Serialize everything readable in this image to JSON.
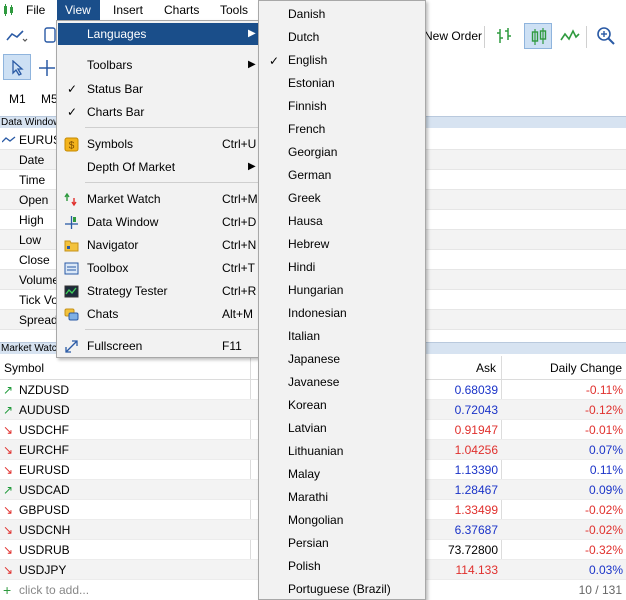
{
  "menubar": {
    "items": [
      "File",
      "View",
      "Insert",
      "Charts",
      "Tools"
    ]
  },
  "toolbar": {
    "new_order_label": "New Order"
  },
  "timeframes": [
    "M1",
    "M5"
  ],
  "data_window": {
    "header": "Data Window",
    "symbol": "EURUSD",
    "rows": [
      "Date",
      "Time",
      "Open",
      "High",
      "Low",
      "Close",
      "Volume",
      "Tick Volume",
      "Spread"
    ]
  },
  "market_watch": {
    "header": "Market Watch",
    "columns": {
      "symbol": "Symbol",
      "ask": "Ask",
      "change": "Daily Change"
    },
    "rows": [
      {
        "symbol": "NZDUSD",
        "dir": "up",
        "ask": "0.68039",
        "ask_color": "blue",
        "change": "-0.11%",
        "chg_color": "red"
      },
      {
        "symbol": "AUDUSD",
        "dir": "up",
        "ask": "0.72043",
        "ask_color": "blue",
        "change": "-0.12%",
        "chg_color": "red"
      },
      {
        "symbol": "USDCHF",
        "dir": "down",
        "ask": "0.91947",
        "ask_color": "red",
        "change": "-0.01%",
        "chg_color": "red"
      },
      {
        "symbol": "EURCHF",
        "dir": "down",
        "ask": "1.04256",
        "ask_color": "red",
        "change": "0.07%",
        "chg_color": "blue"
      },
      {
        "symbol": "EURUSD",
        "dir": "down",
        "ask": "1.13390",
        "ask_color": "blue",
        "change": "0.11%",
        "chg_color": "blue"
      },
      {
        "symbol": "USDCAD",
        "dir": "up",
        "ask": "1.28467",
        "ask_color": "blue",
        "change": "0.09%",
        "chg_color": "blue"
      },
      {
        "symbol": "GBPUSD",
        "dir": "down",
        "ask": "1.33499",
        "ask_color": "red",
        "change": "-0.02%",
        "chg_color": "red"
      },
      {
        "symbol": "USDCNH",
        "dir": "down",
        "ask": "6.37687",
        "ask_color": "blue",
        "change": "-0.02%",
        "chg_color": "red"
      },
      {
        "symbol": "USDRUB",
        "dir": "down",
        "ask": "73.72800",
        "ask_color": "black",
        "change": "-0.32%",
        "chg_color": "red"
      },
      {
        "symbol": "USDJPY",
        "dir": "down",
        "ask": "114.133",
        "ask_color": "red",
        "change": "0.03%",
        "chg_color": "blue"
      }
    ],
    "add_label": "click to add...",
    "count": "10 / 131"
  },
  "view_menu": {
    "items": [
      {
        "label": "Languages",
        "shortcut": "",
        "submenu": true,
        "checked": false
      },
      {
        "label": "Toolbars",
        "shortcut": "",
        "submenu": true,
        "checked": false
      },
      {
        "label": "Status Bar",
        "shortcut": "",
        "submenu": false,
        "checked": true
      },
      {
        "label": "Charts Bar",
        "shortcut": "",
        "submenu": false,
        "checked": true
      },
      {
        "label": "Symbols",
        "shortcut": "Ctrl+U",
        "submenu": false,
        "checked": false
      },
      {
        "label": "Depth Of Market",
        "shortcut": "",
        "submenu": true,
        "checked": false
      },
      {
        "label": "Market Watch",
        "shortcut": "Ctrl+M",
        "submenu": false,
        "checked": false
      },
      {
        "label": "Data Window",
        "shortcut": "Ctrl+D",
        "submenu": false,
        "checked": false
      },
      {
        "label": "Navigator",
        "shortcut": "Ctrl+N",
        "submenu": false,
        "checked": false
      },
      {
        "label": "Toolbox",
        "shortcut": "Ctrl+T",
        "submenu": false,
        "checked": false
      },
      {
        "label": "Strategy Tester",
        "shortcut": "Ctrl+R",
        "submenu": false,
        "checked": false
      },
      {
        "label": "Chats",
        "shortcut": "Alt+M",
        "submenu": false,
        "checked": false
      },
      {
        "label": "Fullscreen",
        "shortcut": "F11",
        "submenu": false,
        "checked": false
      }
    ]
  },
  "languages": {
    "selected": "English",
    "items": [
      "Danish",
      "Dutch",
      "English",
      "Estonian",
      "Finnish",
      "French",
      "Georgian",
      "German",
      "Greek",
      "Hausa",
      "Hebrew",
      "Hindi",
      "Hungarian",
      "Indonesian",
      "Italian",
      "Japanese",
      "Javanese",
      "Korean",
      "Latvian",
      "Lithuanian",
      "Malay",
      "Marathi",
      "Mongolian",
      "Persian",
      "Polish",
      "Portuguese (Brazil)"
    ]
  },
  "colors": {
    "accent": "#1a4e8a",
    "up": "#1f9a3a",
    "down": "#e0302d",
    "blue": "#1a33c8"
  }
}
